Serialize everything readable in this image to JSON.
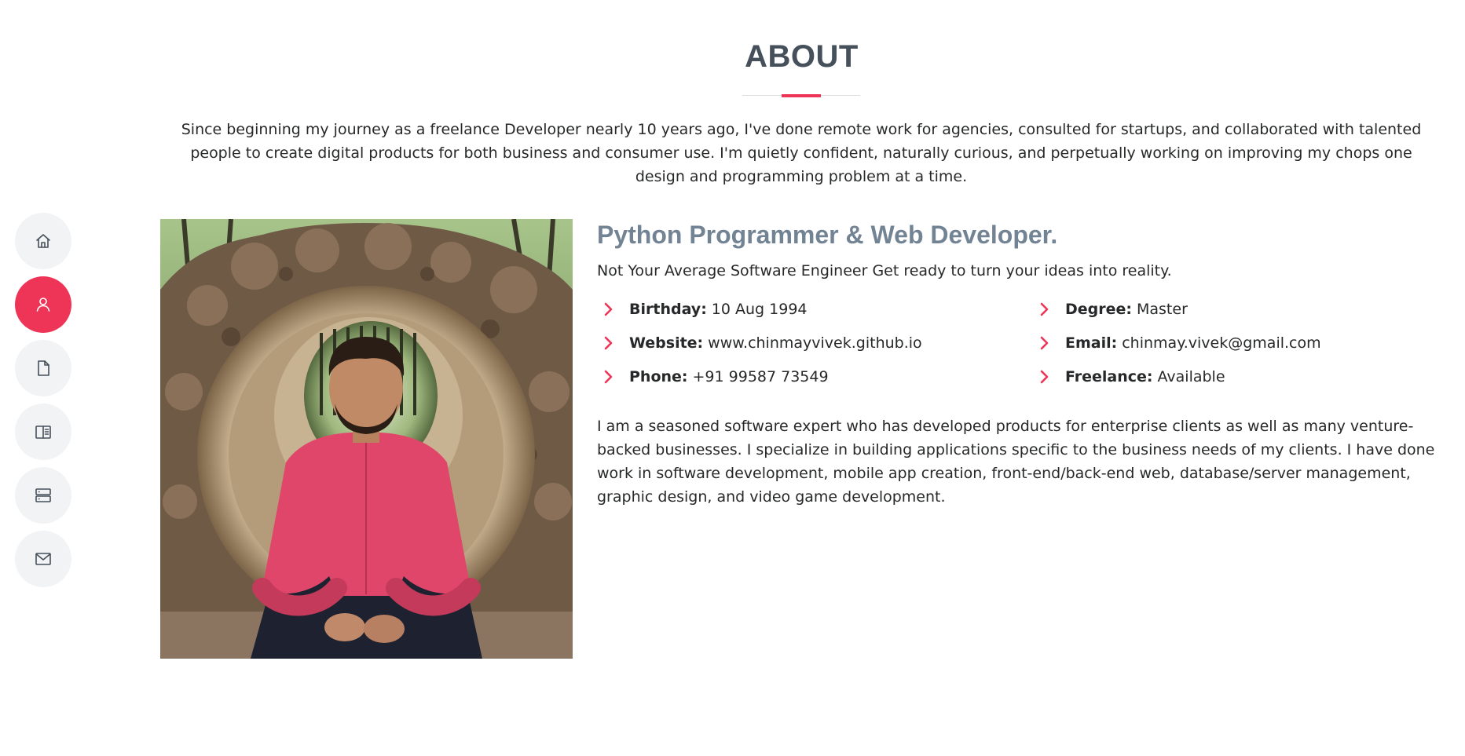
{
  "nav": {
    "items": [
      {
        "icon": "home-icon",
        "active": false
      },
      {
        "icon": "user-icon",
        "active": true
      },
      {
        "icon": "file-icon",
        "active": false
      },
      {
        "icon": "book-icon",
        "active": false
      },
      {
        "icon": "server-icon",
        "active": false
      },
      {
        "icon": "envelope-icon",
        "active": false
      }
    ]
  },
  "about": {
    "title": "ABOUT",
    "intro": "Since beginning my journey as a freelance Developer nearly 10 years ago, I've done remote work for agencies, consulted for startups, and collaborated with talented people to create digital products for both business and consumer use. I'm quietly confident, naturally curious, and perpetually working on improving my chops one design and programming problem at a time.",
    "heading": "Python Programmer & Web Developer.",
    "tagline": "Not Your Average Software Engineer Get ready to turn your ideas into reality.",
    "info": {
      "birthday": {
        "label": "Birthday:",
        "value": "10 Aug 1994"
      },
      "degree": {
        "label": "Degree:",
        "value": "Master"
      },
      "website": {
        "label": "Website:",
        "value": "www.chinmayvivek.github.io"
      },
      "email": {
        "label": "Email:",
        "value": "chinmay.vivek@gmail.com"
      },
      "phone": {
        "label": "Phone:",
        "value": "+91 99587 73549"
      },
      "freelance": {
        "label": "Freelance:",
        "value": "Available"
      }
    },
    "bio": "I am a seasoned software expert who has developed products for enterprise clients as well as many venture-backed businesses. I specialize in building applications specific to the business needs of my clients. I have done work in software development, mobile app creation, front-end/back-end web, database/server management, graphic design, and video game development."
  },
  "colors": {
    "accent": "#ee3457",
    "title": "#45505b",
    "heading": "#728394",
    "nav_bg": "#f2f3f5",
    "text": "#272829"
  }
}
